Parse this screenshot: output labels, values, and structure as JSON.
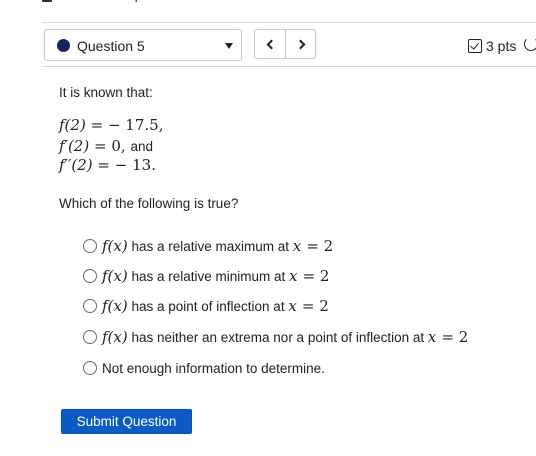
{
  "question_nav": {
    "current_question": "Question 5",
    "prev_label": "<",
    "next_label": ">",
    "points": "3 pts"
  },
  "problem": {
    "intro": "It is known that:",
    "given": [
      {
        "lhs": "f(2)",
        "rel": "=",
        "rhs": "− 17.5,",
        "suffix": ""
      },
      {
        "lhs": "f′(2)",
        "rel": "=",
        "rhs": "0,",
        "suffix": "and"
      },
      {
        "lhs": "f′′(2)",
        "rel": "=",
        "rhs": "− 13.",
        "suffix": ""
      }
    ],
    "prompt": "Which of the following is true?"
  },
  "choices": [
    {
      "fx": "f(x)",
      "text": " has a relative maximum at ",
      "var": "x",
      "eq": "= 2"
    },
    {
      "fx": "f(x)",
      "text": " has a relative minimum at ",
      "var": "x",
      "eq": "= 2"
    },
    {
      "fx": "f(x)",
      "text": " has a point of inflection at ",
      "var": "x",
      "eq": "= 2"
    },
    {
      "fx": "f(x)",
      "text": " has neither an extrema nor a point of inflection at ",
      "var": "x",
      "eq": "= 2"
    },
    {
      "fx": "",
      "text": "Not enough information to determine.",
      "var": "",
      "eq": ""
    }
  ],
  "submit_label": "Submit Question",
  "top_fragment": {
    "text": "Vo"
  },
  "colors": {
    "accent": "#0a5cc4",
    "status_dot": "#14245c",
    "complete_green": "#39b54a"
  },
  "icons": [
    "checkbox-icon",
    "retry-icon",
    "chevron-left-icon",
    "chevron-right-icon",
    "caret-down-icon"
  ]
}
